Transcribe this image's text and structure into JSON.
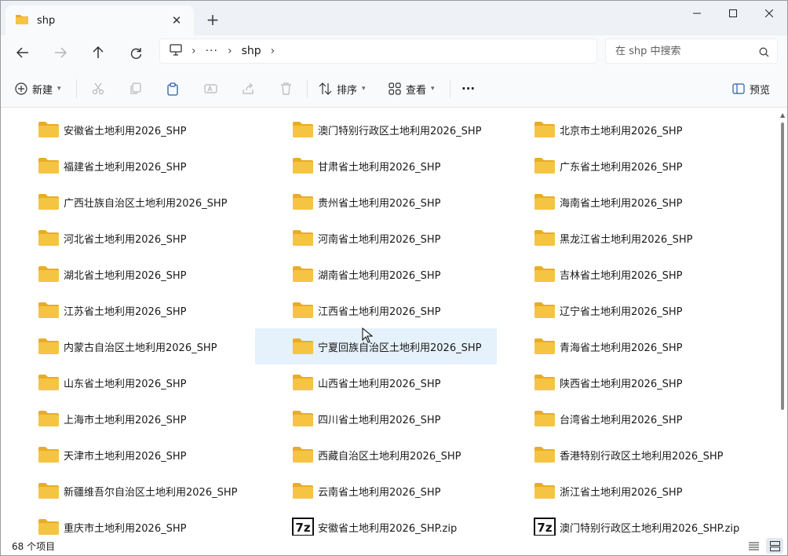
{
  "window": {
    "tab_title": "shp",
    "tab_close": "✕",
    "new_tab": "+",
    "minimize_icon": "minimize-icon",
    "maximize_icon": "maximize-icon",
    "close_icon": "close-icon"
  },
  "nav": {
    "breadcrumb_overflow": "···",
    "breadcrumb_current": "shp",
    "search_placeholder": "在 shp 中搜索"
  },
  "toolbar": {
    "new_label": "新建",
    "sort_label": "排序",
    "view_label": "查看",
    "more_label": "···",
    "preview_label": "预览"
  },
  "files": [
    {
      "name": "安徽省土地利用2026_SHP",
      "type": "folder"
    },
    {
      "name": "澳门特别行政区土地利用2026_SHP",
      "type": "folder"
    },
    {
      "name": "北京市土地利用2026_SHP",
      "type": "folder"
    },
    {
      "name": "福建省土地利用2026_SHP",
      "type": "folder"
    },
    {
      "name": "甘肃省土地利用2026_SHP",
      "type": "folder"
    },
    {
      "name": "广东省土地利用2026_SHP",
      "type": "folder"
    },
    {
      "name": "广西壮族自治区土地利用2026_SHP",
      "type": "folder"
    },
    {
      "name": "贵州省土地利用2026_SHP",
      "type": "folder"
    },
    {
      "name": "海南省土地利用2026_SHP",
      "type": "folder"
    },
    {
      "name": "河北省土地利用2026_SHP",
      "type": "folder"
    },
    {
      "name": "河南省土地利用2026_SHP",
      "type": "folder"
    },
    {
      "name": "黑龙江省土地利用2026_SHP",
      "type": "folder"
    },
    {
      "name": "湖北省土地利用2026_SHP",
      "type": "folder"
    },
    {
      "name": "湖南省土地利用2026_SHP",
      "type": "folder"
    },
    {
      "name": "吉林省土地利用2026_SHP",
      "type": "folder"
    },
    {
      "name": "江苏省土地利用2026_SHP",
      "type": "folder"
    },
    {
      "name": "江西省土地利用2026_SHP",
      "type": "folder"
    },
    {
      "name": "辽宁省土地利用2026_SHP",
      "type": "folder"
    },
    {
      "name": "内蒙古自治区土地利用2026_SHP",
      "type": "folder"
    },
    {
      "name": "宁夏回族自治区土地利用2026_SHP",
      "type": "folder",
      "selected": true
    },
    {
      "name": "青海省土地利用2026_SHP",
      "type": "folder"
    },
    {
      "name": "山东省土地利用2026_SHP",
      "type": "folder"
    },
    {
      "name": "山西省土地利用2026_SHP",
      "type": "folder"
    },
    {
      "name": "陕西省土地利用2026_SHP",
      "type": "folder"
    },
    {
      "name": "上海市土地利用2026_SHP",
      "type": "folder"
    },
    {
      "name": "四川省土地利用2026_SHP",
      "type": "folder"
    },
    {
      "name": "台湾省土地利用2026_SHP",
      "type": "folder"
    },
    {
      "name": "天津市土地利用2026_SHP",
      "type": "folder"
    },
    {
      "name": "西藏自治区土地利用2026_SHP",
      "type": "folder"
    },
    {
      "name": "香港特别行政区土地利用2026_SHP",
      "type": "folder"
    },
    {
      "name": "新疆维吾尔自治区土地利用2026_SHP",
      "type": "folder"
    },
    {
      "name": "云南省土地利用2026_SHP",
      "type": "folder"
    },
    {
      "name": "浙江省土地利用2026_SHP",
      "type": "folder"
    },
    {
      "name": "重庆市土地利用2026_SHP",
      "type": "folder"
    },
    {
      "name": "安徽省土地利用2026_SHP.zip",
      "type": "zip"
    },
    {
      "name": "澳门特别行政区土地利用2026_SHP.zip",
      "type": "zip"
    }
  ],
  "status": {
    "item_count": "68 个项目"
  },
  "colors": {
    "folder": "#f5c443",
    "folder_dark": "#e8ad26",
    "selection": "#e5f1fb",
    "accent": "#0067c0"
  }
}
